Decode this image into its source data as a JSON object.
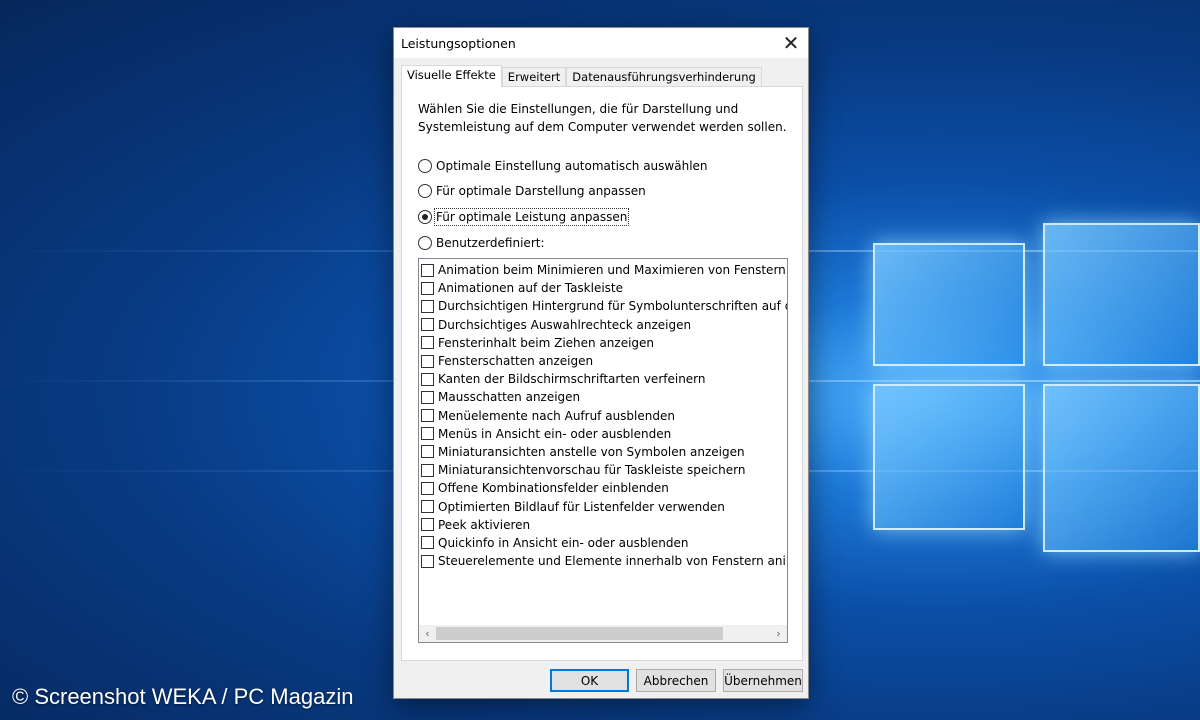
{
  "watermark": "© Screenshot WEKA / PC Magazin",
  "dialog": {
    "title": "Leistungsoptionen",
    "close_icon": "close-icon",
    "tabs": [
      {
        "label": "Visuelle Effekte",
        "active": true
      },
      {
        "label": "Erweitert",
        "active": false
      },
      {
        "label": "Datenausführungsverhinderung",
        "active": false
      }
    ],
    "intro": "Wählen Sie die Einstellungen, die für Darstellung und Systemleistung auf dem Computer verwendet werden sollen.",
    "radios": [
      {
        "label": "Optimale Einstellung automatisch auswählen",
        "selected": false
      },
      {
        "label": "Für optimale Darstellung anpassen",
        "selected": false
      },
      {
        "label": "Für optimale Leistung anpassen",
        "selected": true
      },
      {
        "label": "Benutzerdefiniert:",
        "selected": false
      }
    ],
    "effects": [
      "Animation beim Minimieren und Maximieren von Fenstern",
      "Animationen auf der Taskleiste",
      "Durchsichtigen Hintergrund für Symbolunterschriften auf der",
      "Durchsichtiges Auswahlrechteck anzeigen",
      "Fensterinhalt beim Ziehen anzeigen",
      "Fensterschatten anzeigen",
      "Kanten der Bildschirmschriftarten verfeinern",
      "Mausschatten anzeigen",
      "Menüelemente nach Aufruf ausblenden",
      "Menüs in Ansicht ein- oder ausblenden",
      "Miniaturansichten anstelle von Symbolen anzeigen",
      "Miniaturansichtenvorschau für Taskleiste speichern",
      "Offene Kombinationsfelder einblenden",
      "Optimierten Bildlauf für Listenfelder verwenden",
      "Peek aktivieren",
      "Quickinfo in Ansicht ein- oder ausblenden",
      "Steuerelemente und Elemente innerhalb von Fenstern animie"
    ],
    "scroll_left_icon": "chevron-left-icon",
    "scroll_right_icon": "chevron-right-icon",
    "buttons": {
      "ok": "OK",
      "cancel": "Abbrechen",
      "apply": "Übernehmen"
    }
  }
}
